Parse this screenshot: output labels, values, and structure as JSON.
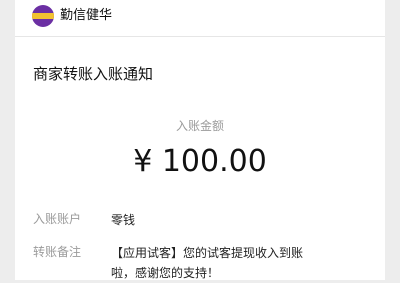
{
  "header": {
    "brand_name": "勤信健华",
    "logo_icon": "brand-logo-icon",
    "accent_color": "#6b2fa3"
  },
  "notice": {
    "title": "商家转账入账通知",
    "amount_label": "入账金额",
    "amount": "¥ 100.00"
  },
  "details": [
    {
      "label": "入账账户",
      "value": "零钱"
    },
    {
      "label": "转账备注",
      "value_line1": "【应用试客】您的试客提现收入到账",
      "value_line2": "啦，感谢您的支持！"
    }
  ]
}
